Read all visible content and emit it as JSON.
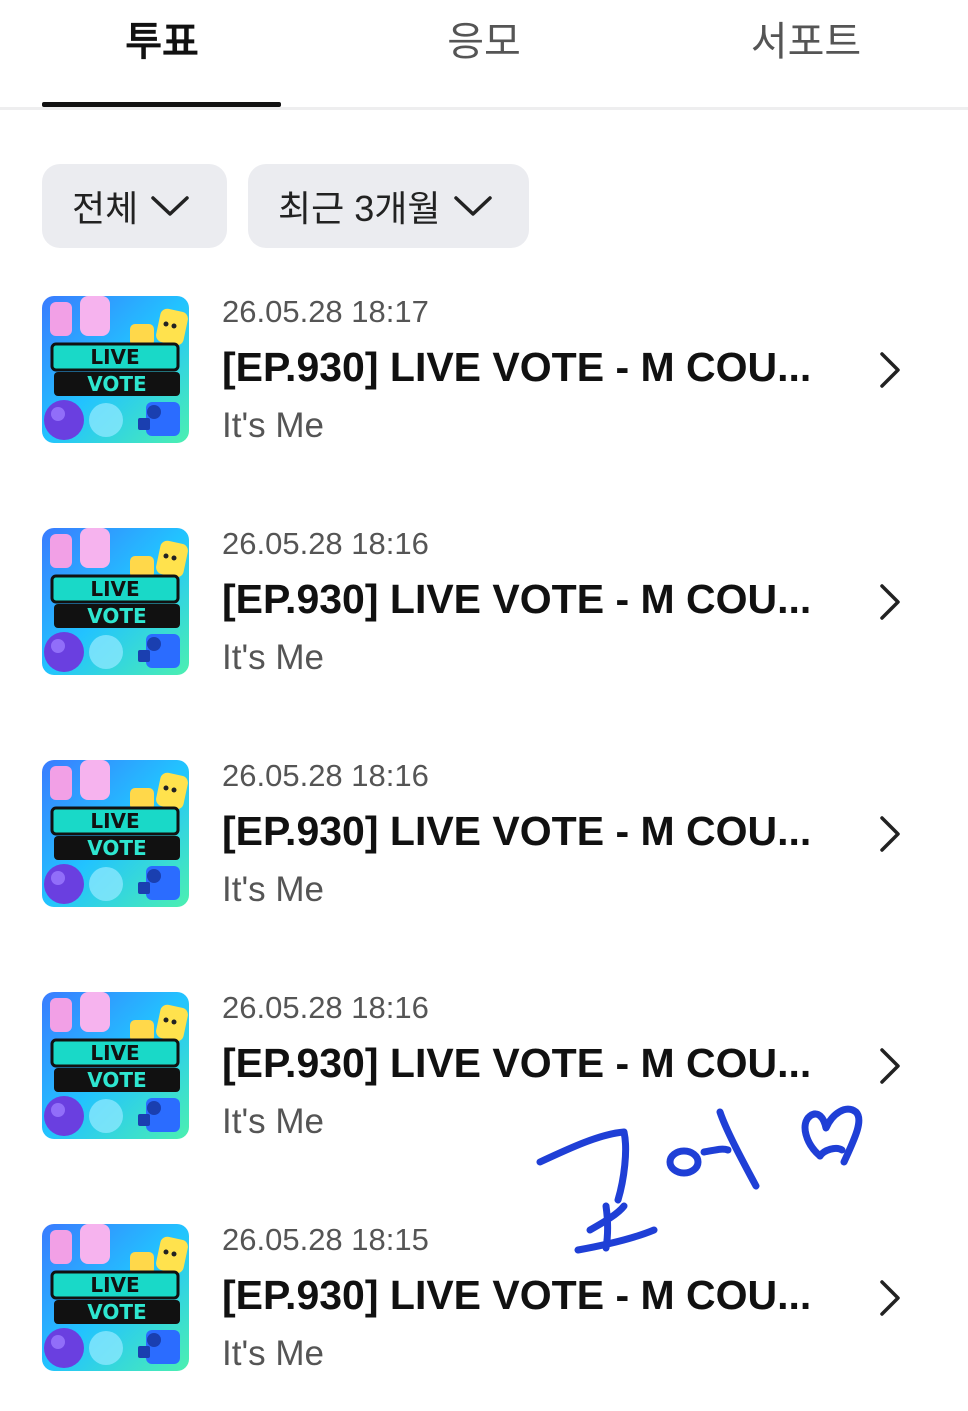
{
  "tabs": [
    {
      "label": "투표",
      "active": true
    },
    {
      "label": "응모",
      "active": false
    },
    {
      "label": "서포트",
      "active": false
    }
  ],
  "filters": {
    "category": "전체",
    "period": "최근 3개월"
  },
  "thumbnail": {
    "line1": "LIVE",
    "line2": "VOTE"
  },
  "items": [
    {
      "date": "26.05.28 18:17",
      "title": "[EP.930] LIVE VOTE - M COU...",
      "subtitle": "It's Me"
    },
    {
      "date": "26.05.28 18:16",
      "title": "[EP.930] LIVE VOTE - M COU...",
      "subtitle": "It's Me"
    },
    {
      "date": "26.05.28 18:16",
      "title": "[EP.930] LIVE VOTE - M COU...",
      "subtitle": "It's Me"
    },
    {
      "date": "26.05.28 18:16",
      "title": "[EP.930] LIVE VOTE - M COU...",
      "subtitle": "It's Me"
    },
    {
      "date": "26.05.28 18:15",
      "title": "[EP.930] LIVE VOTE - M COU...",
      "subtitle": "It's Me"
    }
  ],
  "annotation": {
    "text": "코어",
    "color": "#1f3fd6"
  }
}
